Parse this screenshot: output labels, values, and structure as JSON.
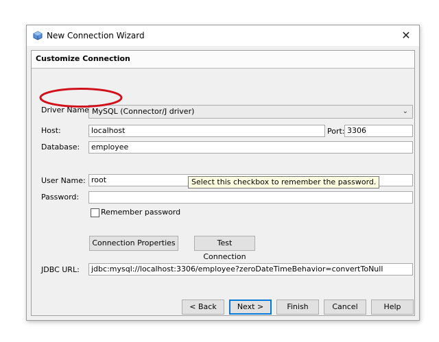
{
  "window": {
    "title": "New Connection Wizard",
    "close_glyph": "✕"
  },
  "section": {
    "title": "Customize Connection"
  },
  "driver": {
    "label": "Driver Name:",
    "value": "MySQL (Connector/J driver)"
  },
  "host": {
    "label": "Host:",
    "value": "localhost"
  },
  "port": {
    "label": "Port:",
    "value": "3306"
  },
  "database": {
    "label": "Database:",
    "value": "employee"
  },
  "user": {
    "label": "User Name:",
    "value": "root"
  },
  "password": {
    "label": "Password:",
    "value": ""
  },
  "remember": {
    "label": "Remember password",
    "checked": false
  },
  "buttons": {
    "connection_properties": "Connection Properties",
    "test_connection": "Test Connection",
    "back": "< Back",
    "next": "Next >",
    "finish": "Finish",
    "cancel": "Cancel",
    "help": "Help"
  },
  "tooltip": {
    "text": "Select this checkbox to remember the password."
  },
  "jdbc": {
    "label": "JDBC URL:",
    "value": "jdbc:mysql://localhost:3306/employee?zeroDateTimeBehavior=convertToNull"
  },
  "colors": {
    "annotation": "#d0101a",
    "default_button_border": "#0078d7"
  },
  "icons": {
    "app": "netbeans-cube-icon",
    "close": "close-icon",
    "dropdown": "chevron-down-icon",
    "checkbox": "checkbox-icon"
  }
}
